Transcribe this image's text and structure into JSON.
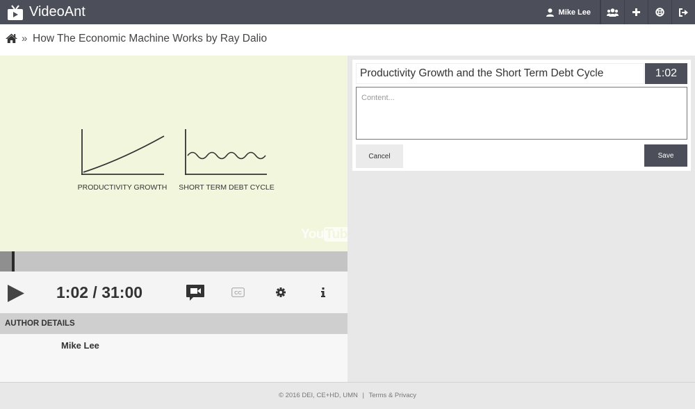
{
  "app": {
    "name": "VideoAnt"
  },
  "nav": {
    "user_name": "Mike Lee",
    "buttons": [
      {
        "icon": "group-icon"
      },
      {
        "icon": "plus-icon"
      },
      {
        "icon": "help-ring-icon"
      },
      {
        "icon": "sign-out-icon"
      }
    ]
  },
  "breadcrumb": {
    "home_icon": "home-icon",
    "separator": "»",
    "title": "How The Economic Machine Works by Ray Dalio"
  },
  "video": {
    "chart_labels": {
      "left": "PRODUCTIVITY GROWTH",
      "right": "SHORT TERM DEBT CYCLE"
    },
    "watermark": {
      "you": "You",
      "tube": "Tube"
    },
    "progress_fraction": 0.033
  },
  "controls": {
    "time_display": "1:02 / 31:00",
    "icons": [
      "play-icon",
      "add-annotation-icon",
      "closed-captions-icon",
      "settings-gear-icon",
      "info-icon"
    ]
  },
  "author": {
    "heading": "AUTHOR DETAILS",
    "name": "Mike Lee"
  },
  "editor": {
    "title_value": "Productivity Growth and the Short Term Debt Cycle",
    "time_badge": "1:02",
    "content_placeholder": "Content...",
    "cancel_label": "Cancel",
    "save_label": "Save"
  },
  "footer": {
    "copyright": "© 2016 DEI, CE+HD, UMN",
    "divider": "|",
    "terms_link": "Terms & Privacy"
  },
  "colors": {
    "topbar": "#4c4f59",
    "video_bg": "#f2f6dd",
    "save_button": "#4c4f59"
  }
}
